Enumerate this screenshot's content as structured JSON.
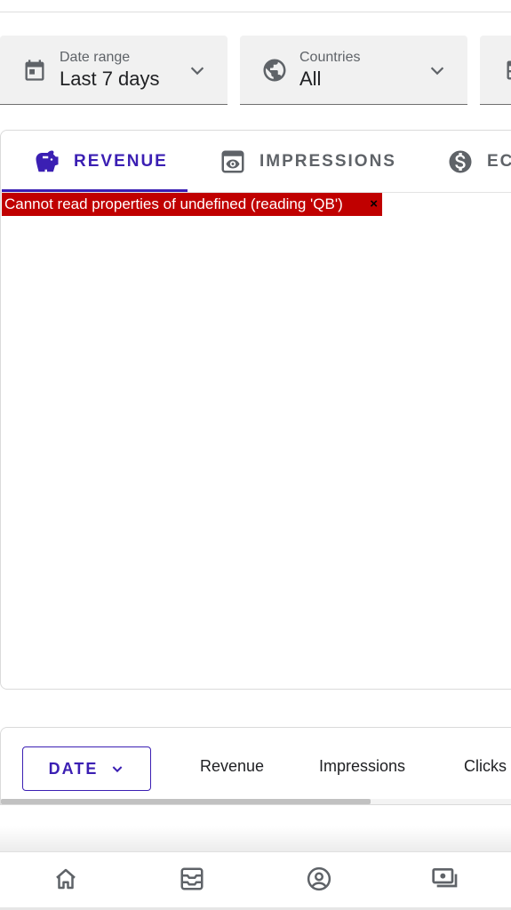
{
  "filters": {
    "date": {
      "label": "Date range",
      "value": "Last 7 days",
      "icon": "calendar-icon"
    },
    "countries": {
      "label": "Countries",
      "value": "All",
      "icon": "globe-icon"
    },
    "third": {
      "icon": "table-icon"
    }
  },
  "tabs": [
    {
      "label": "REVENUE",
      "icon": "piggy-bank-icon",
      "active": true
    },
    {
      "label": "IMPRESSIONS",
      "icon": "eye-icon",
      "active": false
    },
    {
      "label": "EC",
      "icon": "dollar-icon",
      "active": false
    }
  ],
  "error": {
    "message": "Cannot read properties of undefined (reading 'QB')",
    "close": "×"
  },
  "table": {
    "group_button": "DATE",
    "columns": [
      "Revenue",
      "Impressions",
      "Clicks"
    ]
  },
  "bottom_nav": [
    {
      "icon": "home-icon"
    },
    {
      "icon": "inbox-icon"
    },
    {
      "icon": "account-icon"
    },
    {
      "icon": "payments-icon"
    }
  ],
  "colors": {
    "accent": "#3b1fb3",
    "error": "#c00000",
    "icon_gray": "#5f6368"
  }
}
